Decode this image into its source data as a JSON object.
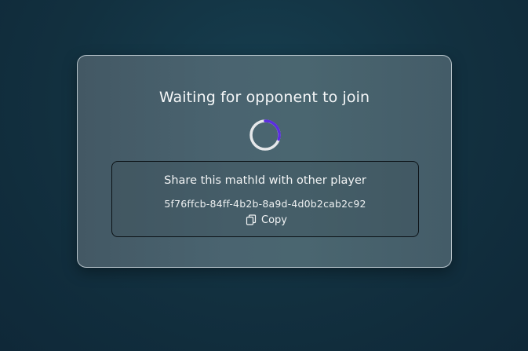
{
  "waiting": {
    "title": "Waiting for opponent to join",
    "spinner_icon": "loading-spinner-icon"
  },
  "share": {
    "label": "Share this mathId with other player",
    "match_id": "5f76ffcb-84ff-4b2b-8a9d-4d0b2cab2c92",
    "copy_label": "Copy",
    "copy_icon": "copy-icon"
  },
  "colors": {
    "spinner_track": "#e6e8ea",
    "spinner_accent": "#5b2ee0",
    "card_border": "#dce6eb"
  }
}
